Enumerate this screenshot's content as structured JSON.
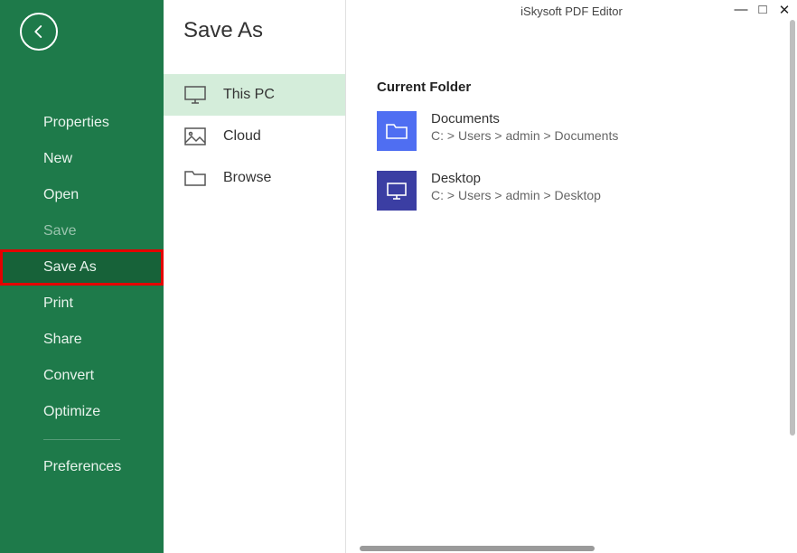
{
  "window": {
    "title": "iSkysoft PDF Editor"
  },
  "sidebar": {
    "items": [
      {
        "label": "Properties"
      },
      {
        "label": "New"
      },
      {
        "label": "Open"
      },
      {
        "label": "Save"
      },
      {
        "label": "Save As"
      },
      {
        "label": "Print"
      },
      {
        "label": "Share"
      },
      {
        "label": "Convert"
      },
      {
        "label": "Optimize"
      },
      {
        "label": "Preferences"
      }
    ]
  },
  "middle": {
    "title": "Save As",
    "options": [
      {
        "label": "This PC"
      },
      {
        "label": "Cloud"
      },
      {
        "label": "Browse"
      }
    ]
  },
  "content": {
    "heading": "Current Folder",
    "folders": [
      {
        "name": "Documents",
        "path": "C: > Users > admin > Documents"
      },
      {
        "name": "Desktop",
        "path": "C: > Users > admin > Desktop"
      }
    ]
  }
}
